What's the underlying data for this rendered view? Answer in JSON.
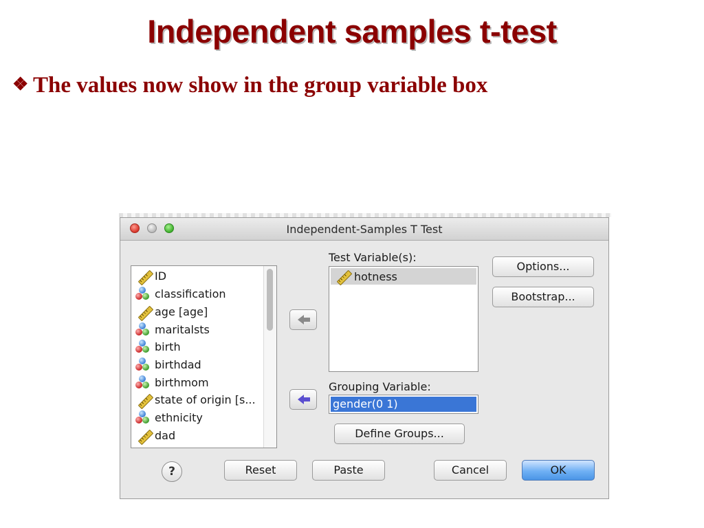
{
  "slide": {
    "title": "Independent samples t-test",
    "bullet": "The values now show in the group variable box",
    "colors": {
      "title": "#8B0000",
      "bullet": "#8B0000"
    }
  },
  "dialog": {
    "title": "Independent-Samples T Test",
    "variables": [
      {
        "label": "ID",
        "icon": "ruler-icon"
      },
      {
        "label": "classification",
        "icon": "nominal-balls-icon"
      },
      {
        "label": "age [age]",
        "icon": "ruler-icon"
      },
      {
        "label": "maritalsts",
        "icon": "nominal-balls-icon"
      },
      {
        "label": "birth",
        "icon": "nominal-balls-icon"
      },
      {
        "label": "birthdad",
        "icon": "nominal-balls-icon"
      },
      {
        "label": "birthmom",
        "icon": "nominal-balls-icon"
      },
      {
        "label": "state of origin [s...",
        "icon": "ruler-icon"
      },
      {
        "label": "ethnicity",
        "icon": "nominal-balls-icon"
      },
      {
        "label": "dad",
        "icon": "ruler-icon"
      }
    ],
    "test_variables_label": "Test Variable(s):",
    "test_variables": [
      {
        "label": "hotness",
        "icon": "ruler-icon"
      }
    ],
    "grouping_label": "Grouping Variable:",
    "grouping_value": "gender(0 1)",
    "buttons": {
      "options": "Options...",
      "bootstrap": "Bootstrap...",
      "define_groups": "Define Groups...",
      "help": "?",
      "reset": "Reset",
      "paste": "Paste",
      "cancel": "Cancel",
      "ok": "OK"
    },
    "colors": {
      "selection": "#3a76d6",
      "ok_button": "#6fb0f4",
      "arrow_active": "#5b4fd0",
      "arrow_inactive": "#8a8a8a"
    }
  }
}
